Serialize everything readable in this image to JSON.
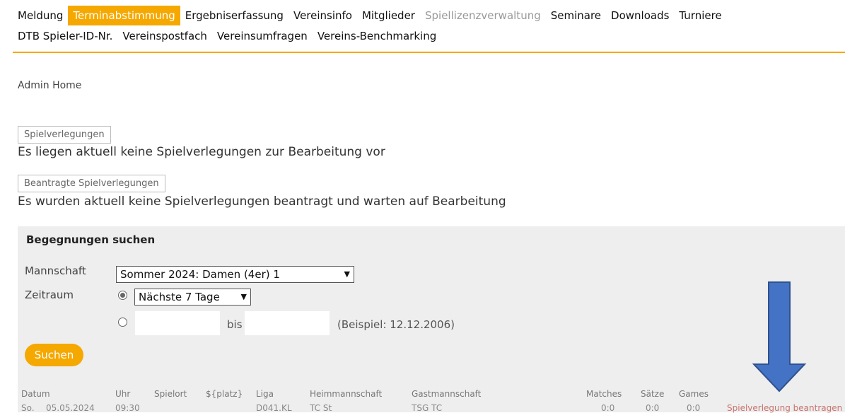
{
  "nav": {
    "row1": [
      {
        "label": "Meldung",
        "state": "normal"
      },
      {
        "label": "Terminabstimmung",
        "state": "active"
      },
      {
        "label": "Ergebniserfassung",
        "state": "normal"
      },
      {
        "label": "Vereinsinfo",
        "state": "normal"
      },
      {
        "label": "Mitglieder",
        "state": "normal"
      },
      {
        "label": "Spiellizenzverwaltung",
        "state": "disabled"
      },
      {
        "label": "Seminare",
        "state": "normal"
      },
      {
        "label": "Downloads",
        "state": "normal"
      },
      {
        "label": "Turniere",
        "state": "normal"
      }
    ],
    "row2": [
      {
        "label": "DTB Spieler-ID-Nr.",
        "state": "normal"
      },
      {
        "label": "Vereinspostfach",
        "state": "normal"
      },
      {
        "label": "Vereinsumfragen",
        "state": "normal"
      },
      {
        "label": "Vereins-Benchmarking",
        "state": "normal"
      }
    ]
  },
  "breadcrumb": "Admin Home",
  "sections": {
    "verlegungen_button": "Spielverlegungen",
    "verlegungen_text": "Es liegen aktuell keine Spielverlegungen zur Bearbeitung vor",
    "beantragt_button": "Beantragte Spielverlegungen",
    "beantragt_text": "Es wurden aktuell keine Spielverlegungen beantragt und warten auf Bearbeitung"
  },
  "search": {
    "title": "Begegnungen suchen",
    "team_label": "Mannschaft",
    "team_value": "Sommer 2024: Damen (4er) 1",
    "period_label": "Zeitraum",
    "period_value": "Nächste 7 Tage",
    "period_option_selected": "preset",
    "bis_label": "bis",
    "example_hint": "(Beispiel: 12.12.2006)",
    "from_value": "",
    "to_value": "",
    "search_button": "Suchen"
  },
  "table": {
    "headers": {
      "datum": "Datum",
      "uhr": "Uhr",
      "spielort": "Spielort",
      "platz": "${platz}",
      "liga": "Liga",
      "heim": "Heimmannschaft",
      "gast": "Gastmannschaft",
      "matches": "Matches",
      "saetze": "Sätze",
      "games": "Games"
    },
    "rows": [
      {
        "day": "So.",
        "date": "05.05.2024",
        "time": "09:30",
        "spielort": "",
        "platz": "",
        "liga": "D041.KL",
        "heim": "TC St",
        "gast": "TSG TC",
        "matches": "0:0",
        "saetze": "0:0",
        "games": "0:0",
        "action": "Spielverlegung beantragen"
      }
    ]
  },
  "colors": {
    "accent": "#f5a800",
    "panel_bg": "#eeeeee",
    "link": "#c9736e",
    "arrow_fill": "#4472c4",
    "arrow_stroke": "#2f528f"
  }
}
